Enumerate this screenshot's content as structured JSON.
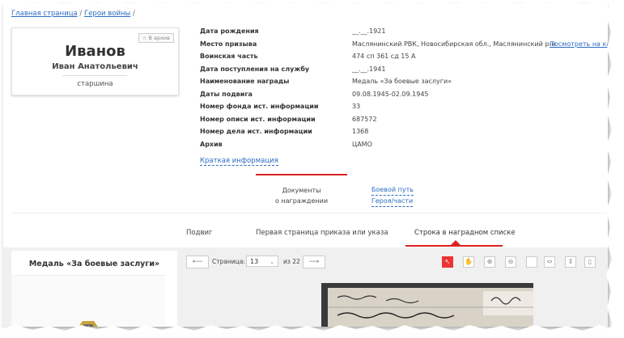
{
  "breadcrumb": {
    "home": "Главная страница",
    "sep": " / ",
    "section": "Герои войны",
    "tail": " /"
  },
  "person": {
    "archive_button": "В архив",
    "surname": "Иванов",
    "given_names": "Иван Анатольевич",
    "rank": "старшина"
  },
  "info": [
    {
      "label": "Дата рождения",
      "value": "__.__.1921"
    },
    {
      "label": "Место призыва",
      "value": "Маслянинский РВК, Новосибирская обл., Маслянинский р-н",
      "link": "Посмотреть на карте"
    },
    {
      "label": "Воинская часть",
      "value": "474 сп 361 сд 15 А"
    },
    {
      "label": "Дата поступления на службу",
      "value": "__.__.1941"
    },
    {
      "label": "Наименование награды",
      "value": "Медаль «За боевые заслуги»"
    },
    {
      "label": "Даты подвига",
      "value": "09.08.1945-02.09.1945"
    },
    {
      "label": "Номер фонда ист. информации",
      "value": "33"
    },
    {
      "label": "Номер описи ист. информации",
      "value": "687572"
    },
    {
      "label": "Номер дела ист. информации",
      "value": "1368"
    },
    {
      "label": "Архив",
      "value": "ЦАМО"
    }
  ],
  "brief_link": "Краткая информация",
  "tabs": {
    "documents_line1": "Документы",
    "documents_line2": "о награждении",
    "path_line1": "Боевой путь",
    "path_line2": "Героя/части"
  },
  "subtabs": [
    "Подвиг",
    "Первая страница приказа или указа",
    "Строка в наградном списке"
  ],
  "viewer": {
    "medal_title": "Медаль «За боевые заслуги»",
    "page_label": "Страница:",
    "page_value": "13",
    "of_label": "из 22"
  },
  "colors": {
    "accent": "#dd2222",
    "link": "#2b6cc4"
  }
}
